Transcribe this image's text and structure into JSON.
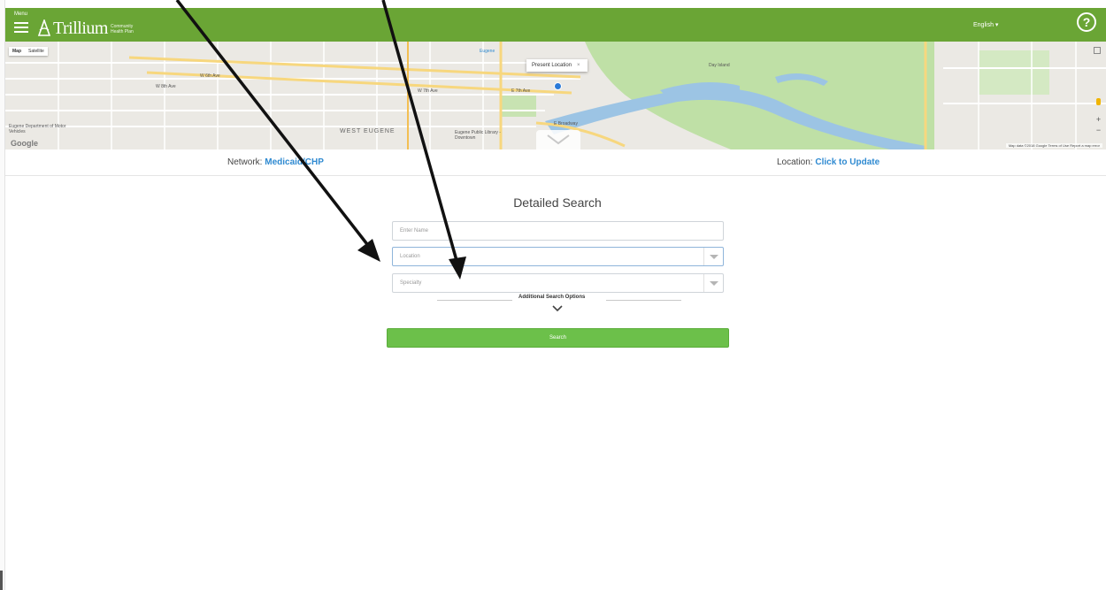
{
  "header": {
    "menu_label": "Menu",
    "logo_name": "Trillium",
    "logo_sub": "Community Health Plan",
    "language": "English ▾",
    "help_icon_text": "?"
  },
  "map": {
    "type_buttons": [
      "Map",
      "Satellite"
    ],
    "present_location": "Present Location",
    "close_x": "×",
    "google": "Google",
    "attribution": "Map data ©2018 Google   Terms of Use   Report a map error",
    "zoom_in": "+",
    "zoom_out": "−",
    "labels": {
      "eugene": "Eugene",
      "e_broadway": "E Broadway",
      "day_island": "Day Island",
      "w_6th": "W 6th Ave",
      "w_7th": "W 7th Ave",
      "e_7th": "E 7th Ave",
      "w_8th": "W 8th Ave",
      "west_eugene": "WEST EUGENE",
      "library": "Eugene Public Library - Downtown",
      "eugene_dept": "Eugene Department of Motor Vehicles"
    }
  },
  "infobar": {
    "network_label": "Network:",
    "network_value": "Medicaid/CHP",
    "location_label": "Location:",
    "location_value": "Click to Update"
  },
  "search": {
    "title": "Detailed Search",
    "name_placeholder": "Enter Name",
    "location_placeholder": "Location",
    "specialty_placeholder": "Specialty",
    "additional_options": "Additional Search Options",
    "search_button": "Search"
  },
  "colors": {
    "topbar": "#6aa535",
    "search_button": "#6cc04a",
    "link": "#2f8ad1"
  }
}
